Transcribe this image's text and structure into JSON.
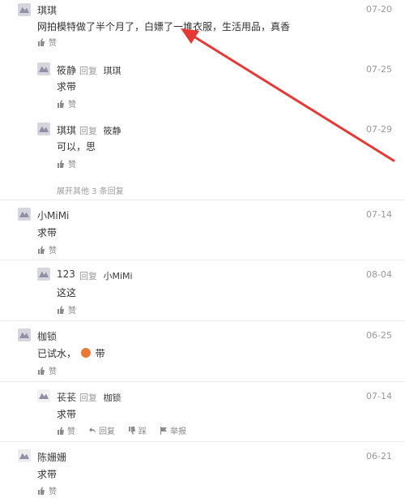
{
  "comments": [
    {
      "name": "琪琪",
      "date": "07-20",
      "text": "网拍模特做了半个月了，白嫖了一堆衣服，生活用品，真香",
      "like": "赞",
      "replies": [
        {
          "name": "筱静",
          "meta": "回复",
          "to": "琪琪",
          "date": "07-25",
          "text": "求带",
          "like": "赞"
        },
        {
          "name": "琪琪",
          "meta": "回复",
          "to": "筱静",
          "date": "07-29",
          "text": "可以，思",
          "like": "赞"
        }
      ],
      "expand": "展开其他 3 条回复"
    },
    {
      "name": "小MiMi",
      "date": "07-14",
      "text": "求带",
      "like": "赞",
      "replies": [
        {
          "name": "123",
          "meta": "回复",
          "to": "小MiMi",
          "date": "08-04",
          "text": "这这",
          "like": "赞"
        }
      ]
    },
    {
      "name": "枷锁",
      "date": "06-25",
      "text": "已试水，",
      "emoji_text": "带",
      "like": "赞",
      "replies": [
        {
          "name": "苌苌",
          "meta": "回复",
          "to": "枷锁",
          "date": "07-14",
          "text": "求带",
          "like": "赞",
          "actions": [
            "回复",
            "踩",
            "举报"
          ]
        }
      ]
    },
    {
      "name": "陈姗姗",
      "date": "06-21",
      "text": "求带",
      "like": "赞"
    }
  ],
  "colors": {
    "arrow": "#e53935",
    "accent": "#e87a35"
  }
}
